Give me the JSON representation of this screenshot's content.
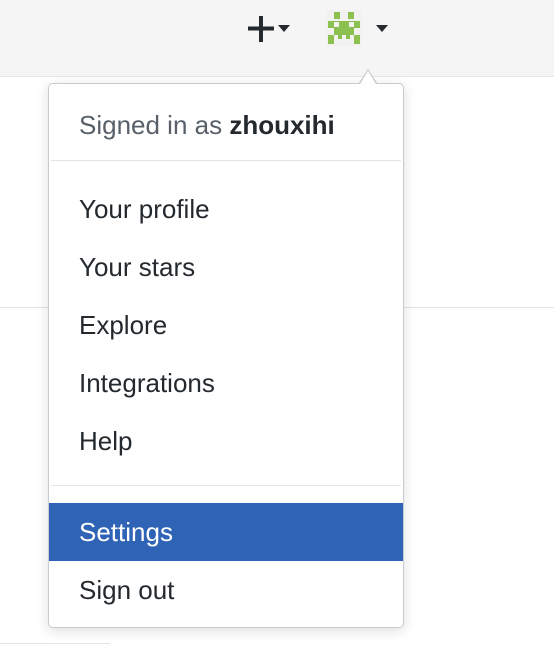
{
  "header": {
    "create_icon": "plus-icon",
    "avatar_icon": "identicon-avatar",
    "caret_icon": "caret-down-icon"
  },
  "dropdown": {
    "signed_in_prefix": "Signed in as ",
    "username": "zhouxihi",
    "items": [
      {
        "label": "Your profile"
      },
      {
        "label": "Your stars"
      },
      {
        "label": "Explore"
      },
      {
        "label": "Integrations"
      },
      {
        "label": "Help"
      },
      {
        "label": "Settings",
        "highlighted": true
      },
      {
        "label": "Sign out"
      }
    ]
  },
  "colors": {
    "highlight": "#2f63b6",
    "avatar_green": "#8cc152",
    "header_bg": "#f5f5f5"
  }
}
